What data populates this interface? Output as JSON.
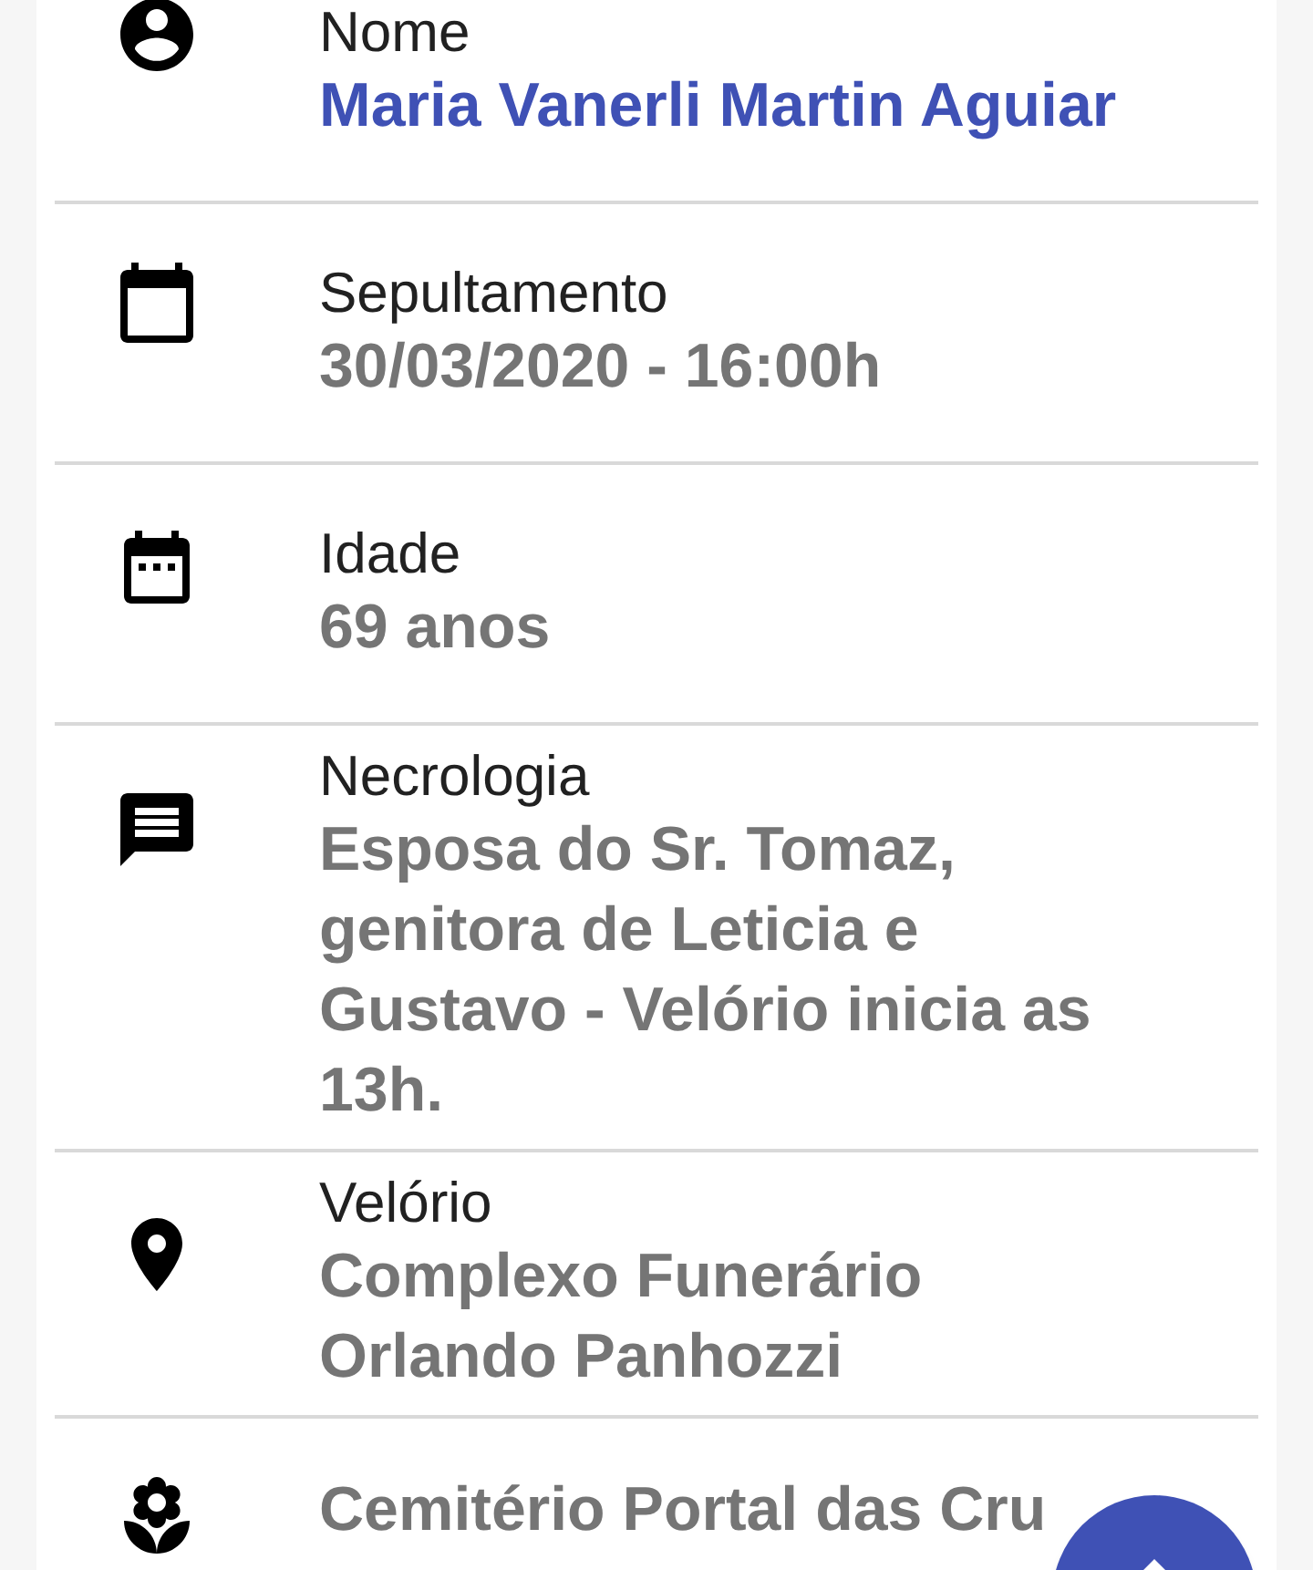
{
  "rows": [
    {
      "label": "Nome",
      "value": "Maria Vanerli Martin Aguiar",
      "highlighted": true
    },
    {
      "label": "Sepultamento",
      "value": "30/03/2020 - 16:00h",
      "highlighted": false
    },
    {
      "label": "Idade",
      "value": "69 anos",
      "highlighted": false
    },
    {
      "label": "Necrologia",
      "value": "Esposa do Sr. Tomaz, genitora de Leticia e Gustavo - Velório inicia as 13h.",
      "highlighted": false
    },
    {
      "label": "Velório",
      "value": "Complexo Funerário Orlando Panhozzi",
      "highlighted": false
    },
    {
      "value": "Cemitério Portal das Cru",
      "highlighted": false
    }
  ]
}
